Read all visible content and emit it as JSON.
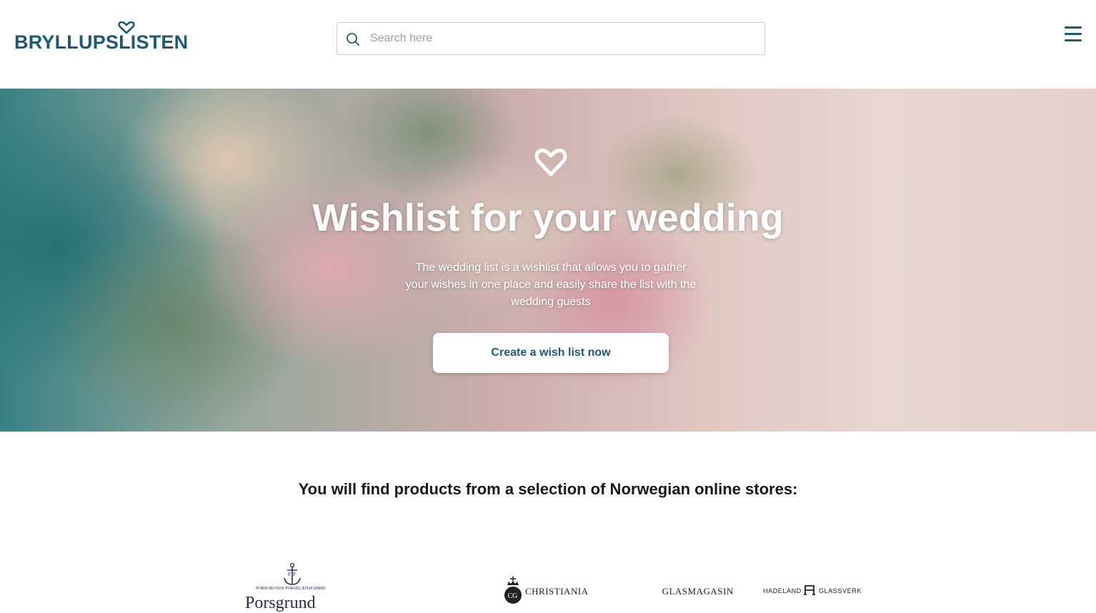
{
  "header": {
    "logo_text": "BRYLLUPSLISTEN",
    "search": {
      "placeholder": "Search here",
      "value": ""
    },
    "menu_icon": "hamburger-menu-icon"
  },
  "hero": {
    "icon": "heart-outline-icon",
    "title": "Wishlist for your wedding",
    "description": "The wedding list is a wishlist that allows you to gather your wishes in one place and easily share the list with the wedding guests",
    "cta_label": "Create a wish list now"
  },
  "stores": {
    "heading": "You will find products from a selection of Norwegian online stores:",
    "porsgrund": {
      "tagline": "PORSGRUNDS PORSELÆNSFABRIK",
      "name": "Porsgrund"
    },
    "christiania": {
      "name": "CHRISTIANIA GLASMAGASIN"
    },
    "hadeland": {
      "left_text": "HADELAND",
      "right_text": "GLASSVERK"
    }
  },
  "colors": {
    "brand": "#1d5a78",
    "text": "#1a1a1a",
    "placeholder": "#9aa0a6"
  }
}
